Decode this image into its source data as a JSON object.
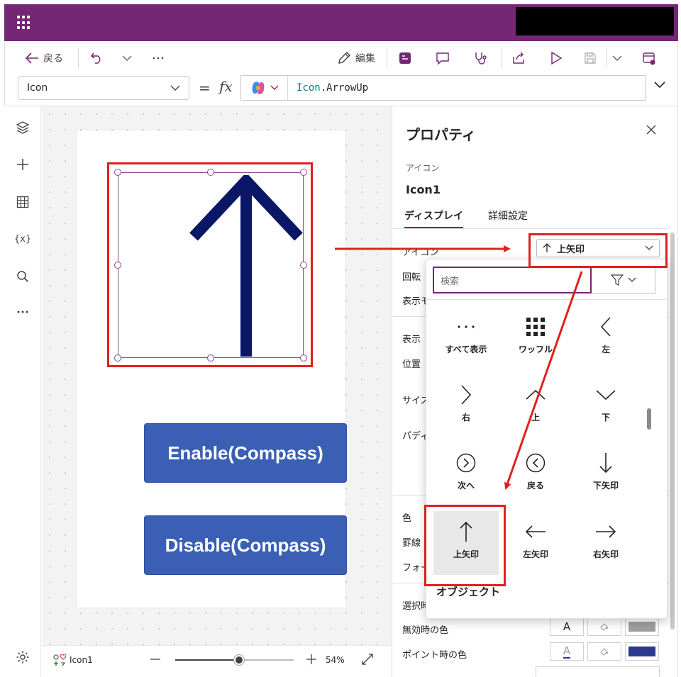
{
  "toolbar": {
    "back_label": "戻る",
    "edit_label": "編集"
  },
  "formula_bar": {
    "property": "Icon",
    "equals": "=",
    "fx": "fx",
    "object_part": "Icon",
    "member_part": ".ArrowUp"
  },
  "canvas": {
    "buttons": [
      {
        "label": "Enable(Compass)"
      },
      {
        "label": "Disable(Compass)"
      }
    ],
    "arrow_color": "#0a1766",
    "button_color": "#3a5fb5"
  },
  "statusbar": {
    "control_name": "Icon1",
    "zoom": "54%",
    "zoom_value": 0.54
  },
  "properties": {
    "title": "プロパティ",
    "type": "アイコン",
    "name": "Icon1",
    "tabs": [
      "ディスプレイ",
      "詳細設定"
    ],
    "rows": {
      "icon": "アイコン",
      "rotation": "回転",
      "display_mode": "表示モ",
      "visible": "表示",
      "position": "位置",
      "size": "サイズ",
      "padding": "パディ",
      "color": "色",
      "border": "罫線",
      "focus": "フォー",
      "selected": "選択時",
      "disabled_color": "無効時の色",
      "hover_color": "ポイント時の色"
    },
    "icon_value": "上矢印",
    "swatch_letter": "A"
  },
  "flyout": {
    "search_placeholder": "検索",
    "items": [
      {
        "label": "すべて表示",
        "icon": "more-horizontal-icon"
      },
      {
        "label": "ワッフル",
        "icon": "waffle-icon"
      },
      {
        "label": "左",
        "icon": "chevron-left-icon"
      },
      {
        "label": "右",
        "icon": "chevron-right-icon"
      },
      {
        "label": "上",
        "icon": "chevron-up-icon"
      },
      {
        "label": "下",
        "icon": "chevron-down-icon"
      },
      {
        "label": "次へ",
        "icon": "next-circle-icon"
      },
      {
        "label": "戻る",
        "icon": "back-circle-icon"
      },
      {
        "label": "下矢印",
        "icon": "arrow-down-icon"
      },
      {
        "label": "上矢印",
        "icon": "arrow-up-icon"
      },
      {
        "label": "左矢印",
        "icon": "arrow-left-icon"
      },
      {
        "label": "右矢印",
        "icon": "arrow-right-icon"
      }
    ],
    "section_label": "オブジェクト"
  },
  "colors": {
    "brand": "#742774",
    "annotation_red": "#e0201e",
    "hover_swatch": "#2b3a8c",
    "disabled_swatch": "#a0a0a0"
  }
}
